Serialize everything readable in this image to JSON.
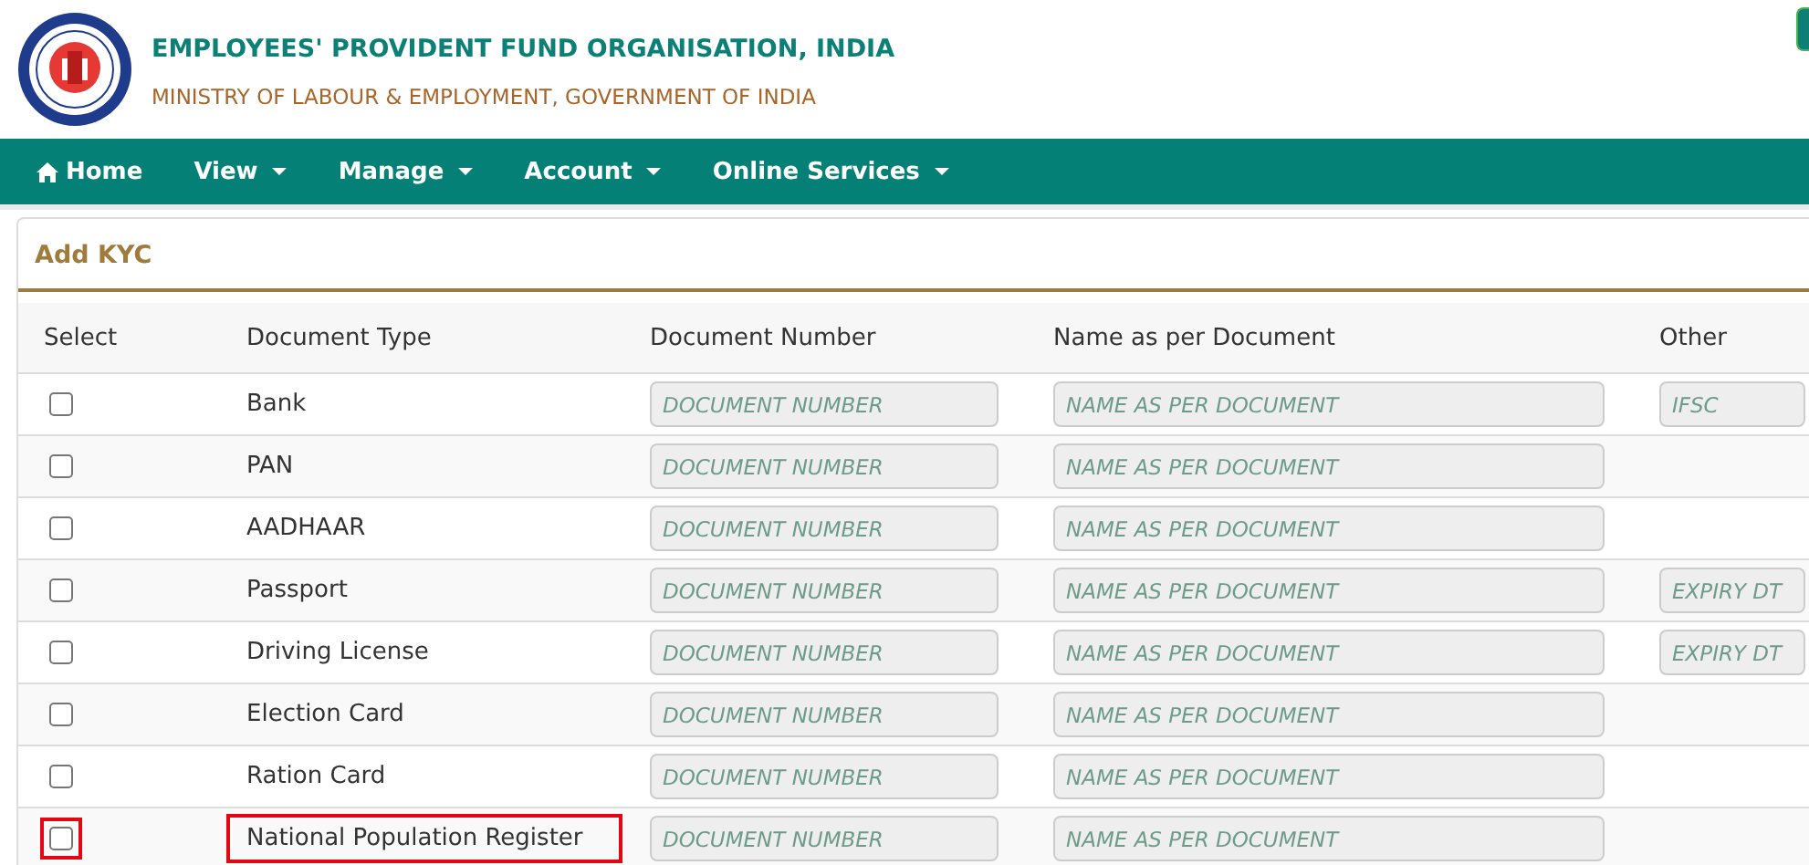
{
  "header": {
    "title": "EMPLOYEES' PROVIDENT FUND ORGANISATION, INDIA",
    "subtitle": "MINISTRY OF LABOUR & EMPLOYMENT, GOVERNMENT OF INDIA"
  },
  "nav": [
    {
      "label": "Home",
      "kind": "home"
    },
    {
      "label": "View",
      "kind": "dropdown"
    },
    {
      "label": "Manage",
      "kind": "dropdown"
    },
    {
      "label": "Account",
      "kind": "dropdown"
    },
    {
      "label": "Online Services",
      "kind": "dropdown"
    }
  ],
  "panel": {
    "title": "Add KYC"
  },
  "table": {
    "columns": [
      "Select",
      "Document Type",
      "Document Number",
      "Name as per Document",
      "Other"
    ],
    "rows": [
      {
        "checked": false,
        "highlighted": false,
        "type": "Bank",
        "number_placeholder": "DOCUMENT NUMBER",
        "name_placeholder": "NAME AS PER DOCUMENT",
        "other_placeholder": "IFSC"
      },
      {
        "checked": false,
        "highlighted": false,
        "type": "PAN",
        "number_placeholder": "DOCUMENT NUMBER",
        "name_placeholder": "NAME AS PER DOCUMENT"
      },
      {
        "checked": false,
        "highlighted": false,
        "type": "AADHAAR",
        "number_placeholder": "DOCUMENT NUMBER",
        "name_placeholder": "NAME AS PER DOCUMENT"
      },
      {
        "checked": false,
        "highlighted": false,
        "type": "Passport",
        "number_placeholder": "DOCUMENT NUMBER",
        "name_placeholder": "NAME AS PER DOCUMENT",
        "other_placeholder": "EXPIRY DT"
      },
      {
        "checked": false,
        "highlighted": false,
        "type": "Driving License",
        "number_placeholder": "DOCUMENT NUMBER",
        "name_placeholder": "NAME AS PER DOCUMENT",
        "other_placeholder": "EXPIRY DT"
      },
      {
        "checked": false,
        "highlighted": false,
        "type": "Election Card",
        "number_placeholder": "DOCUMENT NUMBER",
        "name_placeholder": "NAME AS PER DOCUMENT"
      },
      {
        "checked": false,
        "highlighted": false,
        "type": "Ration Card",
        "number_placeholder": "DOCUMENT NUMBER",
        "name_placeholder": "NAME AS PER DOCUMENT"
      },
      {
        "checked": false,
        "highlighted": true,
        "type": "National Population Register",
        "number_placeholder": "DOCUMENT NUMBER",
        "name_placeholder": "NAME AS PER DOCUMENT"
      }
    ]
  }
}
